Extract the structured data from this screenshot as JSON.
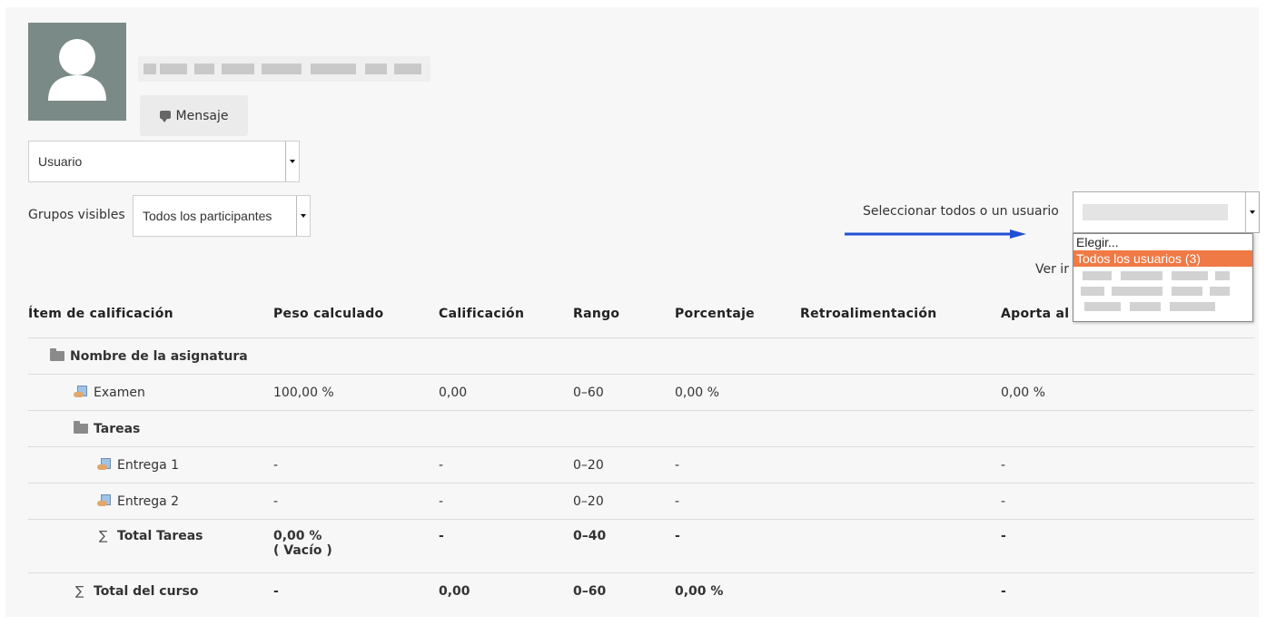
{
  "user": {
    "message_label": "Mensaje"
  },
  "view_select": {
    "value": "Usuario"
  },
  "groups": {
    "label": "Grupos visibles",
    "value": "Todos los participantes"
  },
  "user_select": {
    "label": "Seleccionar todos o un usuario",
    "partial_link": "Ver ir",
    "options": [
      "Elegir...",
      "Todos los usuarios (3)"
    ]
  },
  "table": {
    "headers": [
      "Ítem de calificación",
      "Peso calculado",
      "Calificación",
      "Rango",
      "Porcentaje",
      "Retroalimentación",
      "Aporta al"
    ],
    "rows": [
      {
        "item": "Nombre de la asignatura",
        "peso": "",
        "calif": "",
        "rango": "",
        "pct": "",
        "retro": "",
        "aporta": ""
      },
      {
        "item": "Examen",
        "peso": "100,00 %",
        "calif": "0,00",
        "rango": "0–60",
        "pct": "0,00 %",
        "retro": "",
        "aporta": "0,00 %"
      },
      {
        "item": "Tareas",
        "peso": "",
        "calif": "",
        "rango": "",
        "pct": "",
        "retro": "",
        "aporta": ""
      },
      {
        "item": "Entrega 1",
        "peso": "-",
        "calif": "-",
        "rango": "0–20",
        "pct": "-",
        "retro": "",
        "aporta": "-"
      },
      {
        "item": "Entrega 2",
        "peso": "-",
        "calif": "-",
        "rango": "0–20",
        "pct": "-",
        "retro": "",
        "aporta": "-"
      },
      {
        "item": "Total Tareas",
        "peso": "0,00 %",
        "peso2": "( Vacío )",
        "calif": "-",
        "rango": "0–40",
        "pct": "-",
        "retro": "",
        "aporta": "-"
      },
      {
        "item": "Total del curso",
        "peso": "-",
        "calif": "0,00",
        "rango": "0–60",
        "pct": "0,00 %",
        "retro": "",
        "aporta": "-"
      }
    ]
  },
  "colors": {
    "accent": "#ef7a45",
    "arrow": "#1f4fd6",
    "avatar_bg": "#7a8a87"
  }
}
